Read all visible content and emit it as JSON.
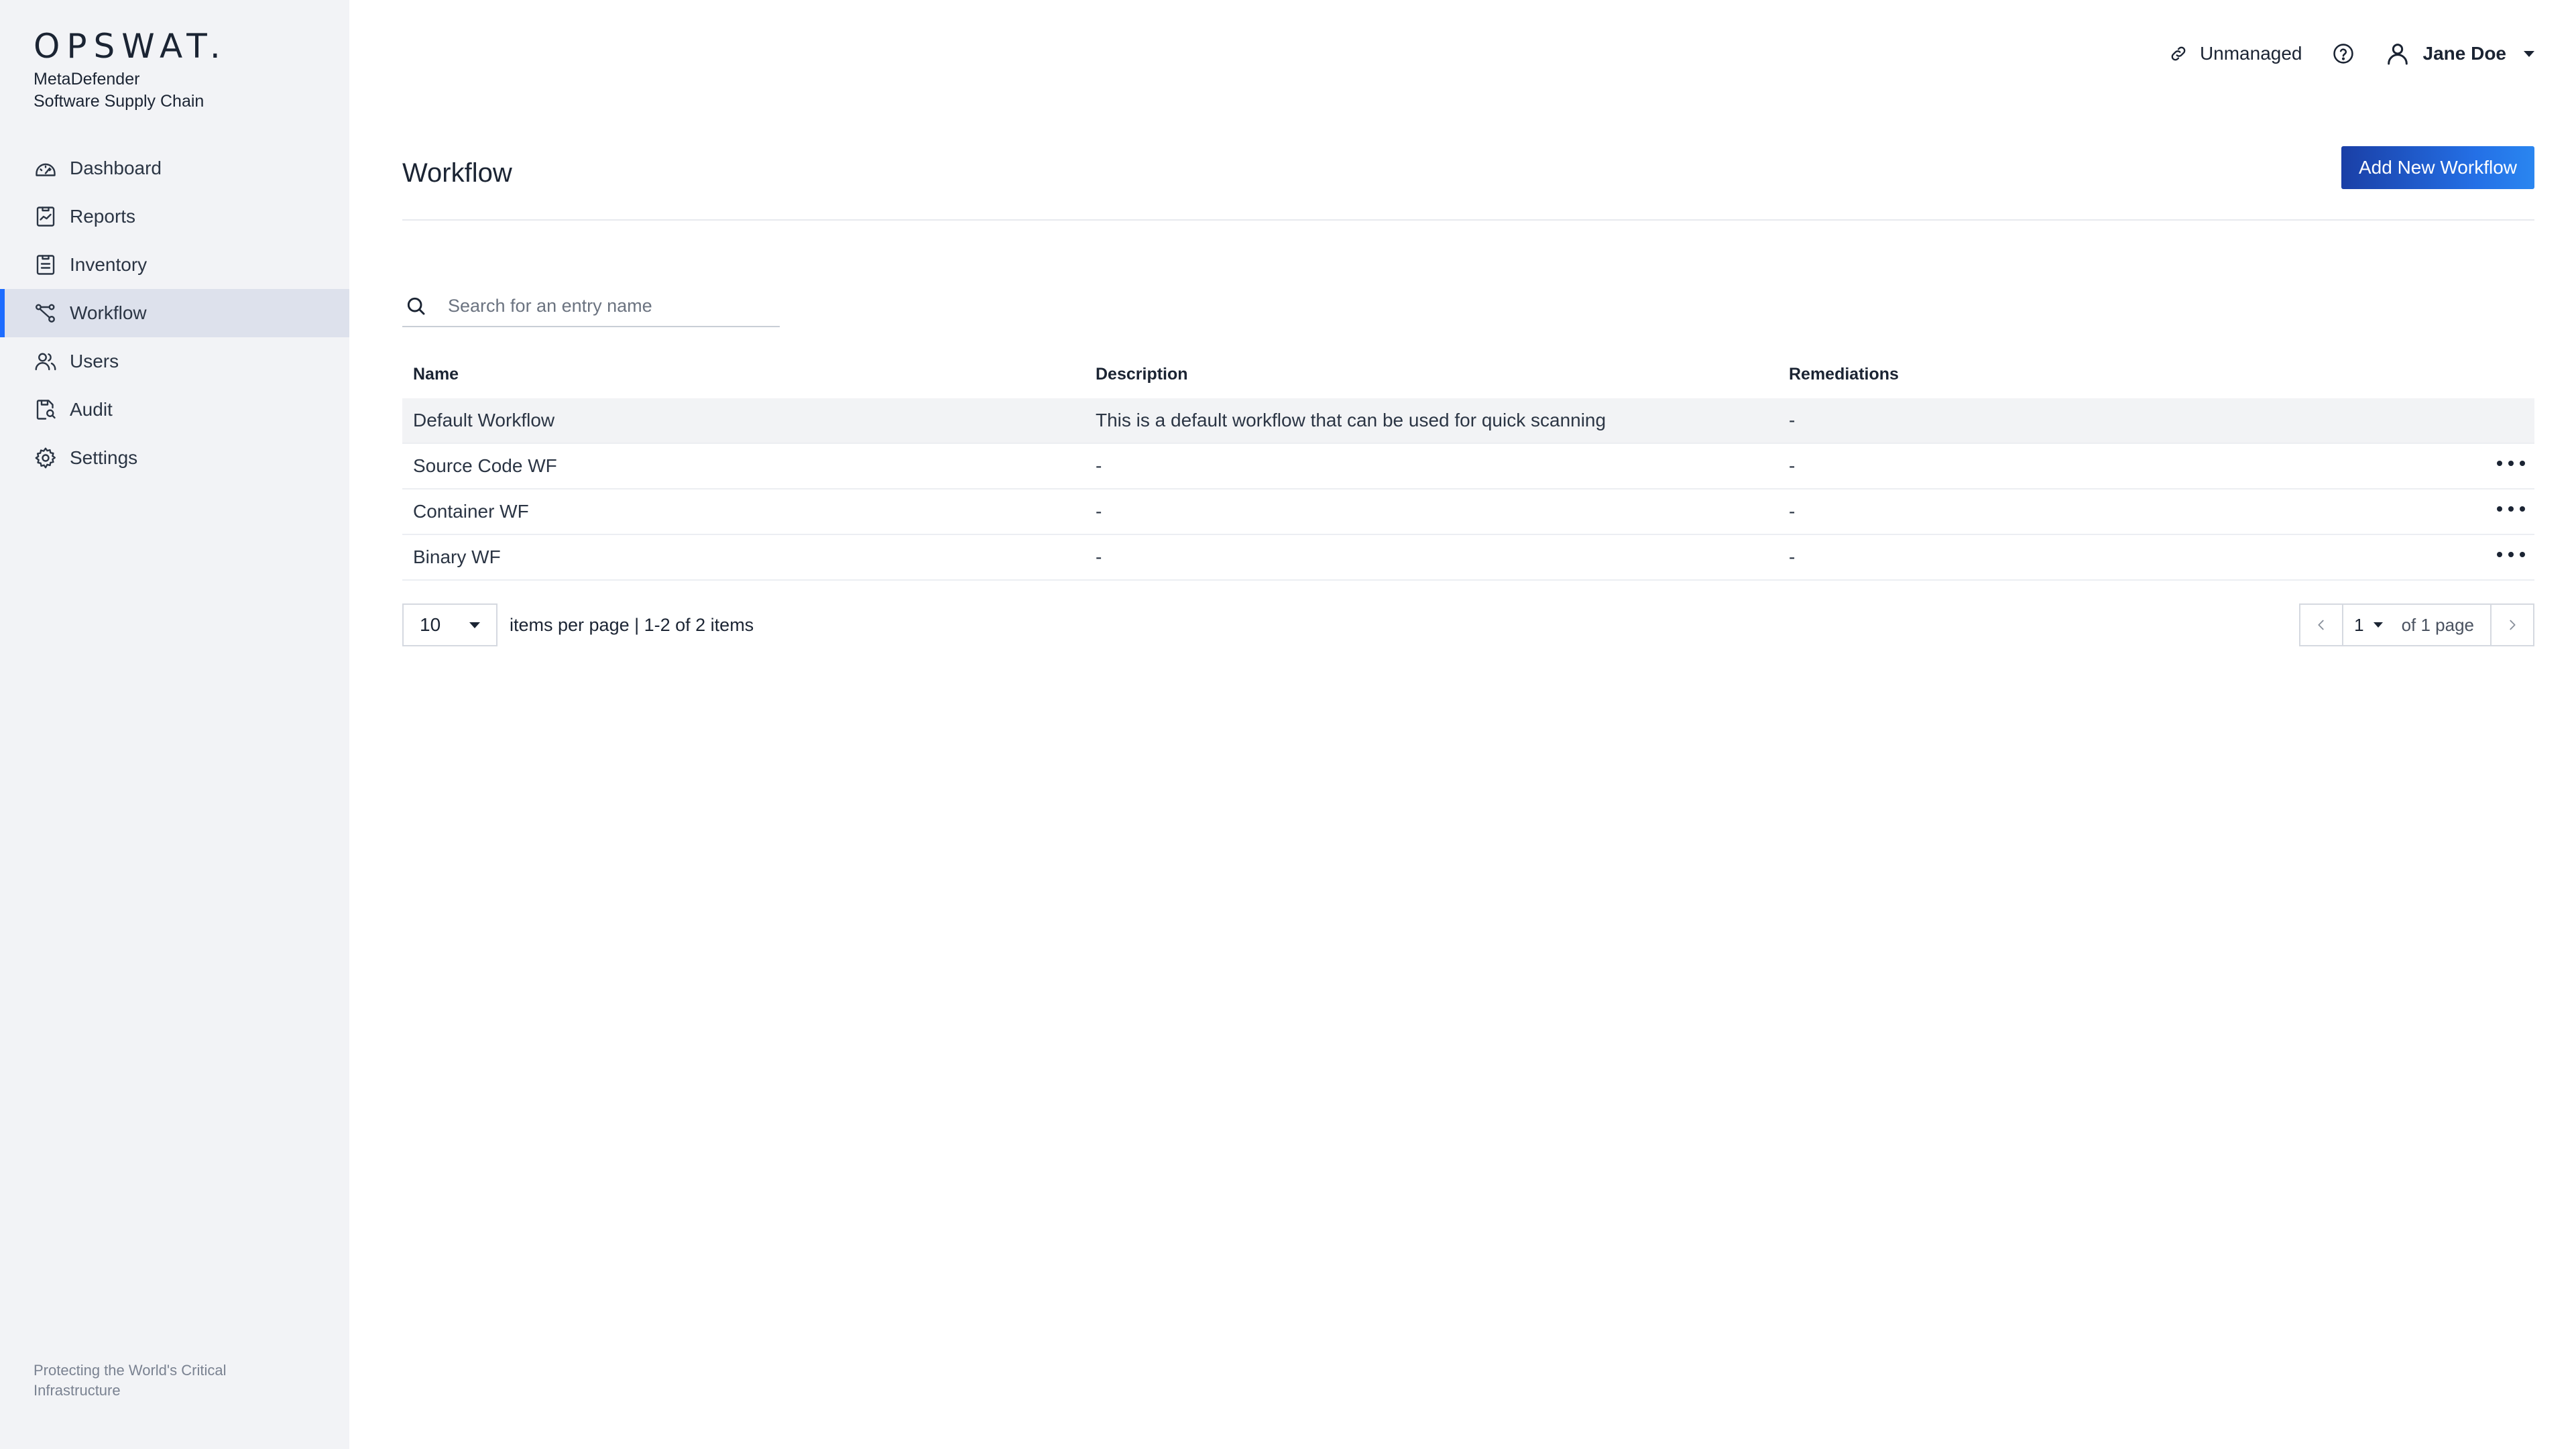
{
  "brand": {
    "logo": "OPSWAT.",
    "product_line1": "MetaDefender",
    "product_line2": "Software Supply Chain"
  },
  "sidebar": {
    "items": [
      {
        "label": "Dashboard",
        "icon": "dashboard-icon"
      },
      {
        "label": "Reports",
        "icon": "reports-icon"
      },
      {
        "label": "Inventory",
        "icon": "inventory-icon"
      },
      {
        "label": "Workflow",
        "icon": "workflow-icon",
        "active": true
      },
      {
        "label": "Users",
        "icon": "users-icon"
      },
      {
        "label": "Audit",
        "icon": "audit-icon"
      },
      {
        "label": "Settings",
        "icon": "settings-icon"
      }
    ],
    "footer": "Protecting the World's Critical Infrastructure"
  },
  "topbar": {
    "unmanaged": "Unmanaged",
    "user_name": "Jane Doe"
  },
  "page": {
    "title": "Workflow",
    "add_button": "Add New Workflow"
  },
  "search": {
    "placeholder": "Search for an entry name",
    "value": ""
  },
  "table": {
    "headers": {
      "name": "Name",
      "description": "Description",
      "remediations": "Remediations"
    },
    "rows": [
      {
        "name": "Default Workflow",
        "description": "This is a default workflow that can be used for quick scanning",
        "remediations": "-"
      },
      {
        "name": "Source Code WF",
        "description": "-",
        "remediations": "-"
      },
      {
        "name": "Container WF",
        "description": "-",
        "remediations": "-"
      },
      {
        "name": "Binary WF",
        "description": "-",
        "remediations": "-"
      }
    ]
  },
  "pagination": {
    "per_page": "10",
    "info": "items per page | 1-2 of 2 items",
    "current_page": "1",
    "of_pages": "of 1 page"
  },
  "colors": {
    "accent": "#1d6cff",
    "button_start": "#1a3fa6",
    "button_end": "#2a86f0",
    "sidebar_bg": "#f2f3f6",
    "active_bg": "#dde1ec"
  }
}
